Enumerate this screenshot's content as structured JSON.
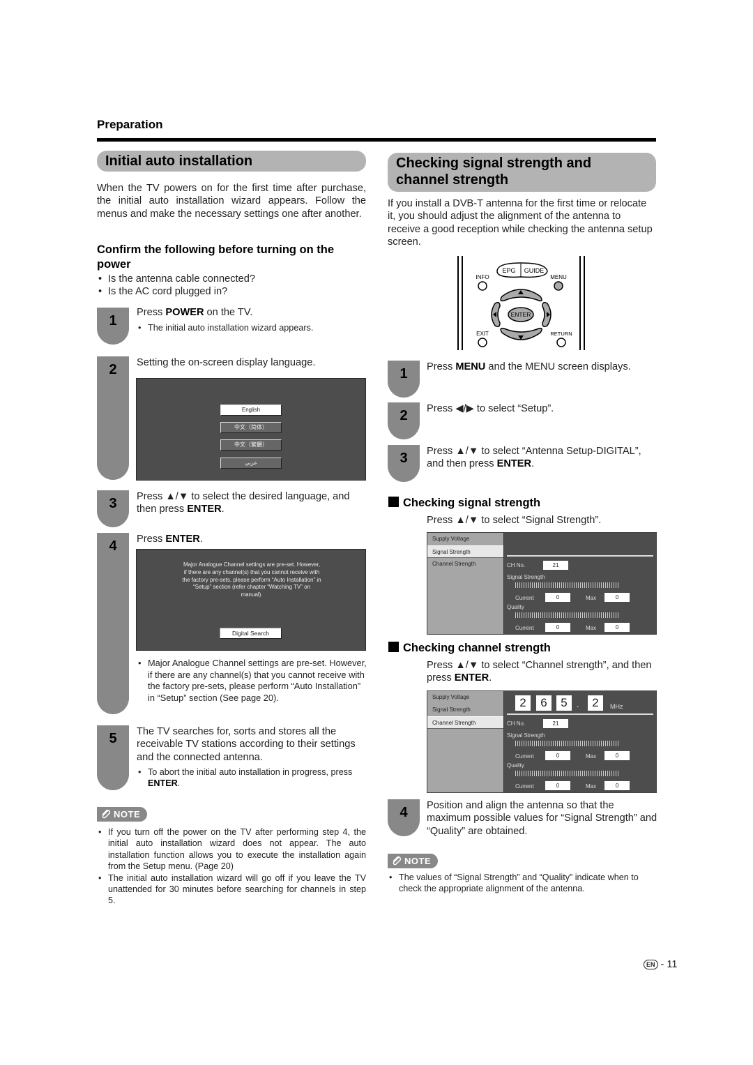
{
  "header": {
    "section": "Preparation"
  },
  "left": {
    "title": "Initial auto installation",
    "intro": "When the TV powers on for the first time after purchase, the initial auto installation wizard appears. Follow the menus and make the necessary settings one after another.",
    "confirm_heading": "Confirm the following  before turning on the power",
    "confirm_items": [
      "Is the antenna cable connected?",
      "Is the AC cord plugged in?"
    ],
    "steps": [
      {
        "num": "1",
        "pre": "Press ",
        "bold": "POWER",
        "post": " on the TV.",
        "bullets": [
          "The initial auto installation wizard appears."
        ]
      },
      {
        "num": "2",
        "text": "Setting the on-screen display language."
      },
      {
        "num": "3",
        "pre": "Press ▲/▼ to select the desired language, and then press ",
        "bold": "ENTER",
        "post": "."
      },
      {
        "num": "4",
        "pre": "Press ",
        "bold": "ENTER",
        "post": ".",
        "bullets": [
          "Major Analogue Channel settings are pre-set. However, if there are any channel(s) that you cannot receive with the factory pre-sets, please perform “Auto Installation” in “Setup” section (See page 20)."
        ]
      },
      {
        "num": "5",
        "text": "The TV searches for, sorts and stores all the receivable TV stations according to their settings and the connected antenna.",
        "bullet_pre": "To abort the initial auto installation in progress, press ",
        "bullet_bold": "ENTER",
        "bullet_post": "."
      }
    ],
    "language_screen": {
      "options": [
        "English",
        "中文（简体）",
        "中文（繁體）",
        "عربي"
      ],
      "selected": "English"
    },
    "preset_screen": {
      "message": "Major Analogue Channel settings are pre-set. However, if there are any channel(s) that you cannot receive with the factory pre-sets, please perform “Auto Installation” in “Setup” section (refer chapter “Watching TV” on manual).",
      "button": "Digital Search"
    },
    "note_label": "NOTE",
    "notes": [
      "If you turn off the power on the TV after performing step 4, the initial auto installation wizard does not appear. The auto installation function allows you to execute the installation again from the Setup menu. (Page 20)",
      "The initial auto installation wizard will go off if you leave the TV unattended for 30 minutes before searching for channels in step 5."
    ]
  },
  "right": {
    "title": "Checking signal strength and channel strength",
    "intro": "If you install a DVB-T antenna for the first time or relocate it, you should adjust the alignment of the antenna to receive a good reception while checking the antenna setup screen.",
    "remote": {
      "info": "INFO",
      "epg": "EPG",
      "guide": "GUIDE",
      "menu": "MENU",
      "enter": "ENTER",
      "exit": "EXIT",
      "return": "RETURN"
    },
    "steps": [
      {
        "num": "1",
        "pre": "Press ",
        "bold": "MENU",
        "post": " and the MENU screen displays."
      },
      {
        "num": "2",
        "text": "Press ◀/▶ to select “Setup”."
      },
      {
        "num": "3",
        "pre": "Press ▲/▼ to select “Antenna Setup-DIGITAL”, and then press ",
        "bold": "ENTER",
        "post": "."
      },
      {
        "num": "4",
        "text": "Position and align the antenna so that the maximum possible values for “Signal Strength” and “Quality” are obtained."
      }
    ],
    "signal_heading": "Checking signal strength",
    "signal_instr": "Press ▲/▼ to select “Signal Strength”.",
    "channel_heading": "Checking channel strength",
    "channel_instr_pre": "Press ▲/▼ to select “Channel strength”, and then press ",
    "channel_instr_bold": "ENTER",
    "channel_instr_post": ".",
    "menu": {
      "items": [
        "Supply Voltage",
        "Signal Strength",
        "Channel Strength"
      ],
      "ch_label": "CH No.",
      "ch_value": "21",
      "signal_label": "Signal Strength",
      "quality_label": "Quality",
      "current_label": "Current",
      "max_label": "Max",
      "signal_current": "0",
      "signal_max": "0",
      "quality_current": "0",
      "quality_max": "0"
    },
    "frequency": {
      "digits": [
        "2",
        "6",
        "5",
        "2"
      ],
      "dot": ".",
      "unit": "MHz"
    },
    "note_label": "NOTE",
    "notes": [
      "The values of “Signal Strength” and “Quality” indicate when to check the appropriate alignment of the antenna."
    ]
  },
  "footer": {
    "lang_badge": "EN",
    "page": "- 11"
  }
}
